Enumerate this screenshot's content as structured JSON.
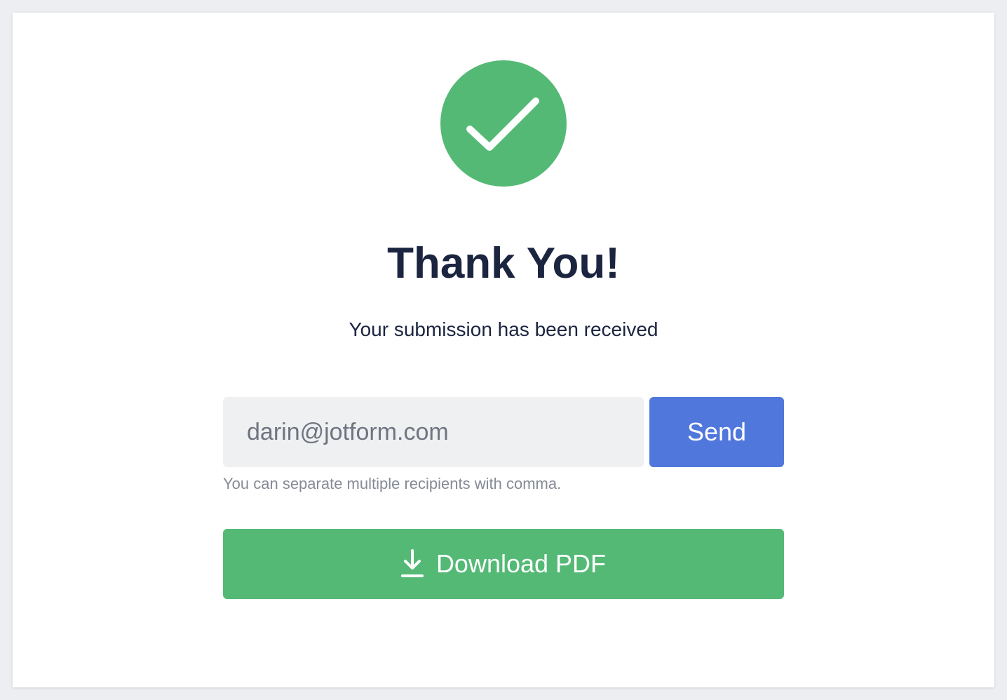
{
  "colors": {
    "success_green": "#55b976",
    "send_blue": "#5077dc",
    "title_navy": "#1c2540"
  },
  "status_icon": "check-circle-icon",
  "title": "Thank You!",
  "subtitle": "Your submission has been received",
  "email": {
    "value": "darin@jotform.com",
    "helper": "You can separate multiple recipients with comma."
  },
  "send_button": {
    "label": "Send"
  },
  "download_button": {
    "icon": "download-icon",
    "label": "Download PDF"
  }
}
